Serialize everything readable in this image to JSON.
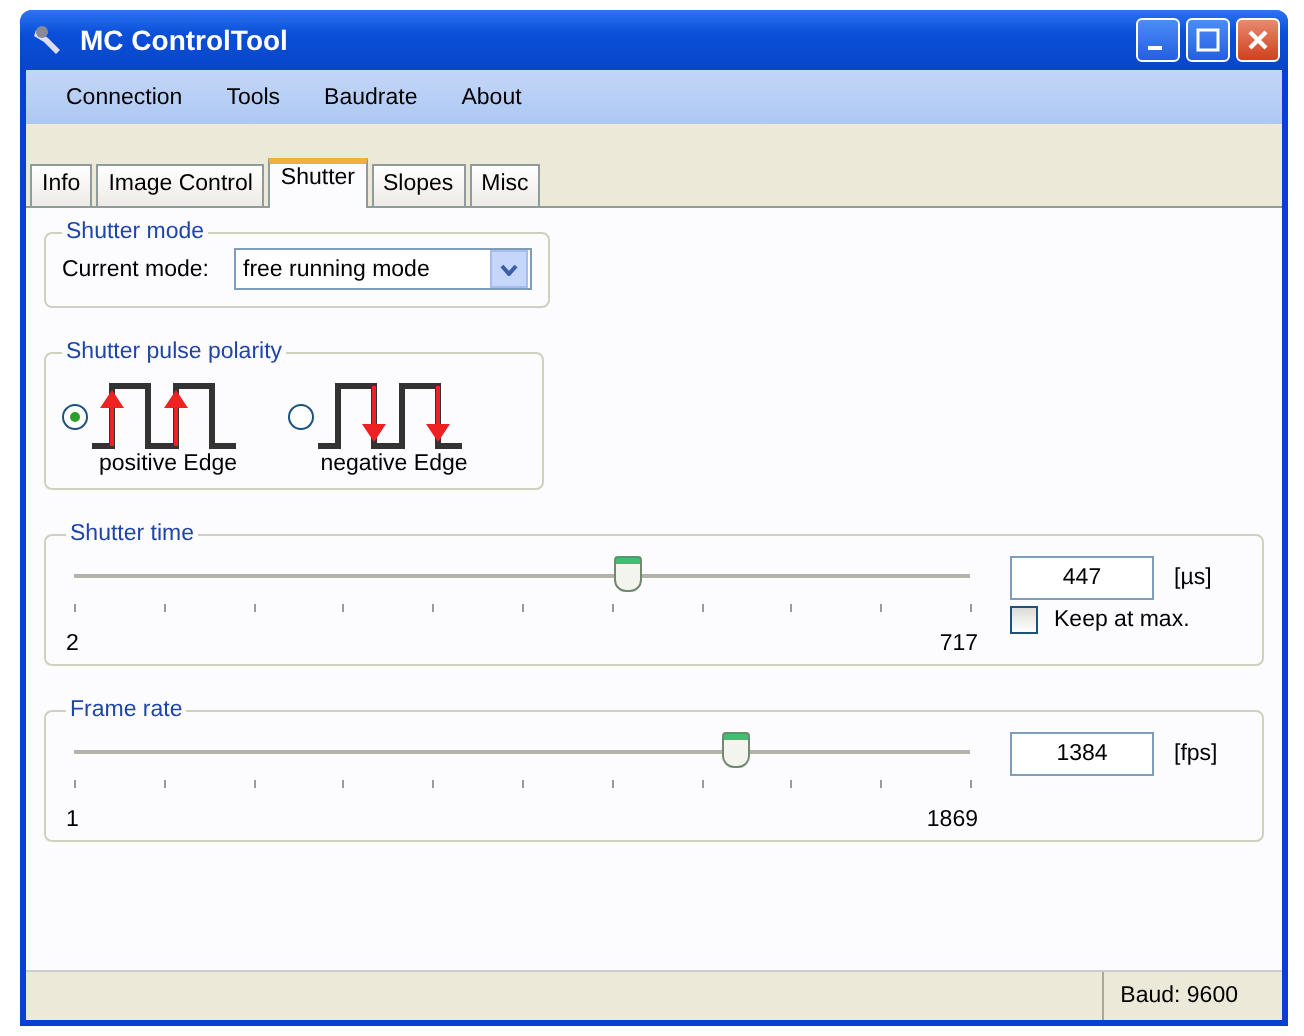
{
  "window": {
    "title": "MC ControlTool"
  },
  "menu": [
    "Connection",
    "Tools",
    "Baudrate",
    "About"
  ],
  "tabs": [
    {
      "label": "Info",
      "selected": false
    },
    {
      "label": "Image Control",
      "selected": false
    },
    {
      "label": "Shutter",
      "selected": true
    },
    {
      "label": "Slopes",
      "selected": false
    },
    {
      "label": "Misc",
      "selected": false
    }
  ],
  "shutter_mode": {
    "title": "Shutter mode",
    "label": "Current mode:",
    "value": "free running mode"
  },
  "polarity": {
    "title": "Shutter pulse polarity",
    "options": [
      {
        "label": "positive Edge",
        "selected": true,
        "kind": "positive"
      },
      {
        "label": "negative Edge",
        "selected": false,
        "kind": "negative"
      }
    ]
  },
  "sliders": [
    {
      "title": "Shutter time",
      "level": 0.62,
      "min": "2",
      "max": "717",
      "value": "447",
      "unit": "[µs]",
      "checkbox": {
        "label": "Keep at max.",
        "checked": false
      }
    },
    {
      "title": "Frame rate",
      "level": 0.74,
      "min": "1",
      "max": "1869",
      "value": "1384",
      "unit": "[fps]"
    }
  ],
  "status_bar": {
    "baud": "Baud: 9600"
  }
}
